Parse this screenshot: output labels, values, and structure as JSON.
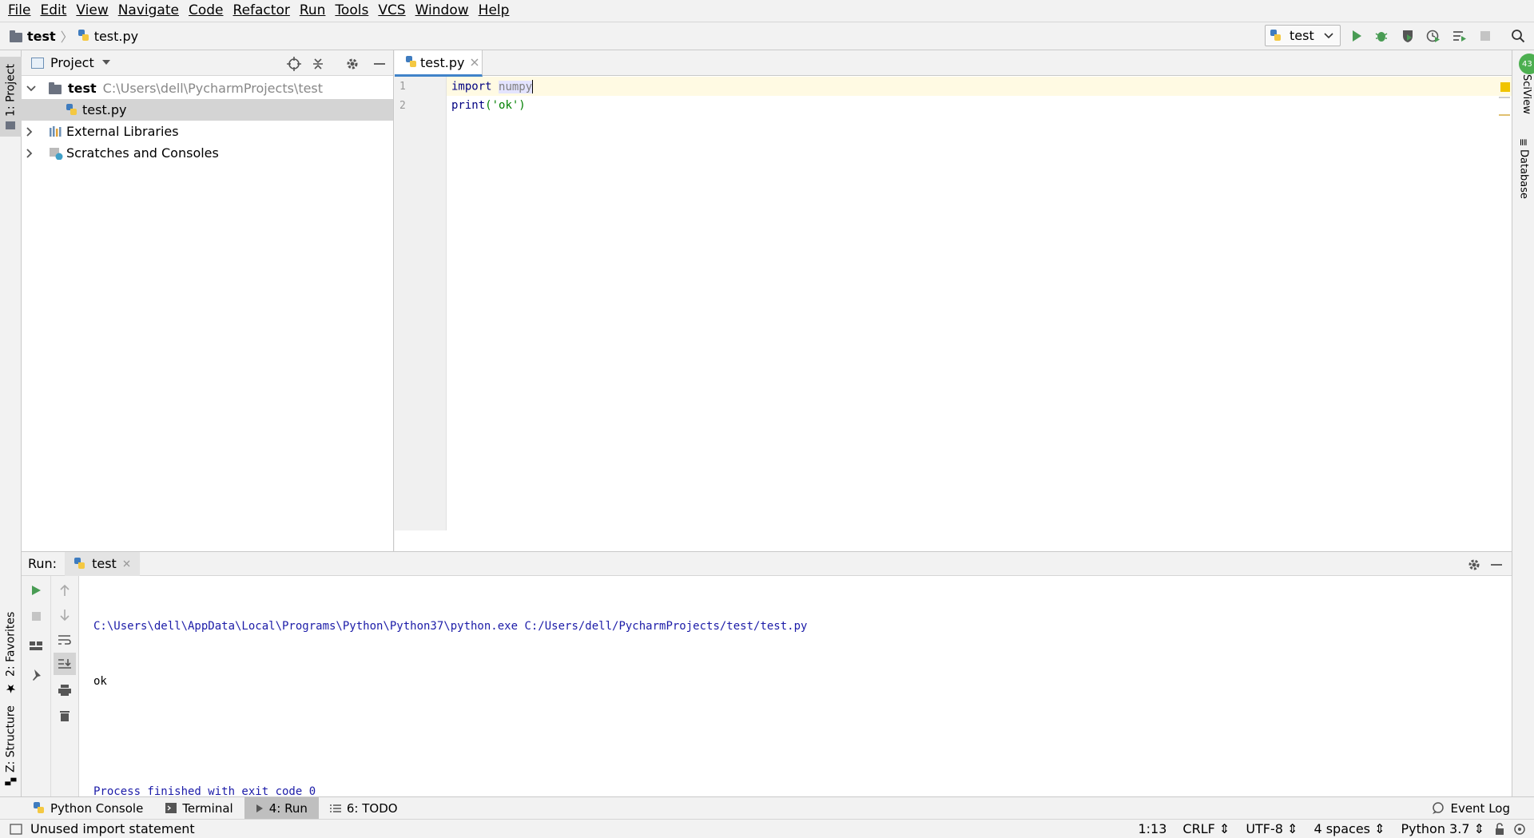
{
  "menu": [
    {
      "label": "File",
      "mnemonic_index": 0
    },
    {
      "label": "Edit",
      "mnemonic_index": 0
    },
    {
      "label": "View",
      "mnemonic_index": 0
    },
    {
      "label": "Navigate",
      "mnemonic_index": 0
    },
    {
      "label": "Code",
      "mnemonic_index": 0
    },
    {
      "label": "Refactor",
      "mnemonic_index": 0
    },
    {
      "label": "Run",
      "mnemonic_index": 0
    },
    {
      "label": "Tools",
      "mnemonic_index": 0
    },
    {
      "label": "VCS",
      "mnemonic_index": 2
    },
    {
      "label": "Window",
      "mnemonic_index": 0
    },
    {
      "label": "Help",
      "mnemonic_index": 0
    }
  ],
  "breadcrumb": {
    "project": "test",
    "file": "test.py"
  },
  "run_config": {
    "name": "test"
  },
  "side_tabs": {
    "project": "1: Project",
    "favorites": "2: Favorites",
    "structure": "Z: Structure",
    "sciview": "SciView",
    "database": "Database",
    "notification_count": "43"
  },
  "project_panel": {
    "title": "Project",
    "tree": [
      {
        "label": "test",
        "path": "C:\\Users\\dell\\PycharmProjects\\test"
      },
      {
        "label": "test.py"
      },
      {
        "label": "External Libraries"
      },
      {
        "label": "Scratches and Consoles"
      }
    ]
  },
  "editor": {
    "tab": "test.py",
    "lines": [
      {
        "num": "1",
        "keyword": "import",
        "rest": "numpy"
      },
      {
        "num": "2",
        "func": "print",
        "args": "('ok')"
      }
    ]
  },
  "run_panel": {
    "label": "Run:",
    "tab": "test",
    "output": [
      "C:\\Users\\dell\\AppData\\Local\\Programs\\Python\\Python37\\python.exe C:/Users/dell/PycharmProjects/test/test.py",
      "ok",
      "",
      "Process finished with exit code 0"
    ]
  },
  "tool_windows": [
    {
      "label": "Python Console"
    },
    {
      "label": "Terminal"
    },
    {
      "label": "4: Run",
      "active": true
    },
    {
      "label": "6: TODO"
    }
  ],
  "event_log": "Event Log",
  "status": {
    "message": "Unused import statement",
    "position": "1:13",
    "line_sep": "CRLF",
    "encoding": "UTF-8",
    "indent": "4 spaces",
    "interpreter": "Python 3.7"
  },
  "colors": {
    "accent": "#4083c9",
    "run_green": "#499c54",
    "console_blue": "#1c1ca8",
    "keyword": "#000080"
  }
}
